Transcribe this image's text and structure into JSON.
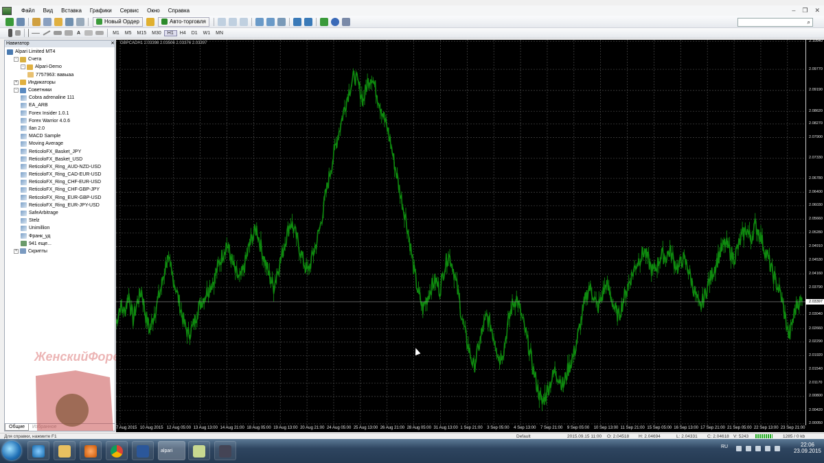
{
  "menu": {
    "items": [
      "Файл",
      "Вид",
      "Вставка",
      "Графики",
      "Сервис",
      "Окно",
      "Справка"
    ]
  },
  "toolbar": {
    "new_order": "Новый Ордер",
    "auto_trading": "Авто-торговля",
    "timeframes": [
      "M1",
      "M5",
      "M15",
      "M30",
      "H1",
      "H4",
      "D1",
      "W1",
      "MN"
    ]
  },
  "navigator": {
    "title": "Навигатор",
    "items": [
      {
        "label": "Alpari Limited MT4",
        "level": 0,
        "icon": "terminal-icon"
      },
      {
        "label": "Счета",
        "level": 1,
        "icon": "accounts-icon",
        "expand": "-"
      },
      {
        "label": "Alpari-Demo",
        "level": 2,
        "icon": "server-icon",
        "expand": "-"
      },
      {
        "label": "7757963: вавыаа",
        "level": 3,
        "icon": "user-icon"
      },
      {
        "label": "Индикаторы",
        "level": 1,
        "icon": "indicators-icon",
        "expand": "+"
      },
      {
        "label": "Советники",
        "level": 1,
        "icon": "experts-icon",
        "expand": "-"
      },
      {
        "label": "Cobra adrenaline 111",
        "level": 2,
        "icon": "ea-icon"
      },
      {
        "label": "EA_ARB",
        "level": 2,
        "icon": "ea-icon"
      },
      {
        "label": "Forex Insider 1.0.1",
        "level": 2,
        "icon": "ea-icon"
      },
      {
        "label": "Forex Warrior 4.0.6",
        "level": 2,
        "icon": "ea-icon"
      },
      {
        "label": "Ilan 2.0",
        "level": 2,
        "icon": "ea-icon"
      },
      {
        "label": "MACD Sample",
        "level": 2,
        "icon": "ea-icon"
      },
      {
        "label": "Moving Average",
        "level": 2,
        "icon": "ea-icon"
      },
      {
        "label": "ReticoloFX_Basket_JPY",
        "level": 2,
        "icon": "ea-icon"
      },
      {
        "label": "ReticoloFX_Basket_USD",
        "level": 2,
        "icon": "ea-icon"
      },
      {
        "label": "ReticoloFX_Ring_AUD-NZD-USD",
        "level": 2,
        "icon": "ea-icon"
      },
      {
        "label": "ReticoloFX_Ring_CAD-EUR-USD",
        "level": 2,
        "icon": "ea-icon"
      },
      {
        "label": "ReticoloFX_Ring_CHF-EUR-USD",
        "level": 2,
        "icon": "ea-icon"
      },
      {
        "label": "ReticoloFX_Ring_CHF-GBP-JPY",
        "level": 2,
        "icon": "ea-icon"
      },
      {
        "label": "ReticoloFX_Ring_EUR-GBP-USD",
        "level": 2,
        "icon": "ea-icon"
      },
      {
        "label": "ReticoloFX_Ring_EUR-JPY-USD",
        "level": 2,
        "icon": "ea-icon"
      },
      {
        "label": "SafeArbitrage",
        "level": 2,
        "icon": "ea-icon"
      },
      {
        "label": "Stelz",
        "level": 2,
        "icon": "ea-icon"
      },
      {
        "label": "Unimillion",
        "level": 2,
        "icon": "ea-icon"
      },
      {
        "label": "Франк_уд",
        "level": 2,
        "icon": "ea-icon"
      },
      {
        "label": "941 еще...",
        "level": 2,
        "icon": "more-icon"
      },
      {
        "label": "Скрипты",
        "level": 1,
        "icon": "scripts-icon",
        "expand": "+"
      }
    ],
    "tabs": [
      "Общие",
      "Избранное"
    ]
  },
  "watermark": "ЖенскийФорекс.ру",
  "chart": {
    "info": "GBPCADH1  2.03398 2.03506 2.03376 2.03397",
    "current_price": "2.03397",
    "line_color": "#0f8a0f",
    "grid_color": "#4a4a4a"
  },
  "chart_data": {
    "type": "line",
    "title": "",
    "xlabel": "",
    "ylabel": "",
    "ylim": [
      2.0001,
      2.1058
    ],
    "y_ticks": [
      "2.10540",
      "2.09770",
      "2.09190",
      "2.08620",
      "2.08270",
      "2.07900",
      "2.07330",
      "2.06780",
      "2.06400",
      "2.06030",
      "2.05660",
      "2.05280",
      "2.04910",
      "2.04530",
      "2.04160",
      "2.03790",
      "2.03397",
      "2.03040",
      "2.02660",
      "2.02290",
      "2.01920",
      "2.01540",
      "2.01170",
      "2.00800",
      "2.00420",
      "2.00050"
    ],
    "x_ticks": [
      "7 Aug 2015",
      "10 Aug 2015",
      "12 Aug 05:00",
      "13 Aug 13:00",
      "14 Aug 21:00",
      "18 Aug 05:00",
      "19 Aug 13:00",
      "20 Aug 21:00",
      "24 Aug 05:00",
      "25 Aug 13:00",
      "26 Aug 21:00",
      "28 Aug 05:00",
      "31 Aug 13:00",
      "1 Sep 21:00",
      "3 Sep 05:00",
      "4 Sep 13:00",
      "7 Sep 21:00",
      "9 Sep 05:00",
      "10 Sep 13:00",
      "11 Sep 21:00",
      "15 Sep 05:00",
      "16 Sep 13:00",
      "17 Sep 21:00",
      "21 Sep 05:00",
      "22 Sep 13:00",
      "23 Sep 21:00"
    ],
    "series": [
      {
        "values": [
          2.028,
          2.033,
          2.031,
          2.036,
          2.029,
          2.034,
          2.037,
          2.03,
          2.026,
          2.031,
          2.035,
          2.04,
          2.046,
          2.042,
          2.038,
          2.033,
          2.028,
          2.025,
          2.027,
          2.031,
          2.034,
          2.036,
          2.038,
          2.04,
          2.044,
          2.047,
          2.05,
          2.046,
          2.042,
          2.04,
          2.043,
          2.048,
          2.052,
          2.054,
          2.049,
          2.045,
          2.041,
          2.038,
          2.043,
          2.047,
          2.052,
          2.056,
          2.053,
          2.049,
          2.045,
          2.042,
          2.046,
          2.05,
          2.055,
          2.062,
          2.068,
          2.074,
          2.079,
          2.084,
          2.089,
          2.093,
          2.096,
          2.093,
          2.089,
          2.094,
          2.096,
          2.092,
          2.088,
          2.084,
          2.08,
          2.074,
          2.068,
          2.062,
          2.057,
          2.05,
          2.042,
          2.036,
          2.032,
          2.035,
          2.038,
          2.04,
          2.037,
          2.043,
          2.047,
          2.044,
          2.038,
          2.031,
          2.025,
          2.02,
          2.016,
          2.021,
          2.026,
          2.03,
          2.027,
          2.023,
          2.018,
          2.021,
          2.028,
          2.033,
          2.035,
          2.031,
          2.026,
          2.021,
          2.015,
          2.01,
          2.006,
          2.009,
          2.012,
          2.015,
          2.013,
          2.011,
          2.015,
          2.018,
          2.022,
          2.028,
          2.034,
          2.038,
          2.036,
          2.032,
          2.035,
          2.039,
          2.036,
          2.032,
          2.03,
          2.034,
          2.038,
          2.041,
          2.044,
          2.046,
          2.048,
          2.045,
          2.042,
          2.044,
          2.047,
          2.046,
          2.048,
          2.045,
          2.043,
          2.046,
          2.044,
          2.04,
          2.036,
          2.032,
          2.035,
          2.039,
          2.042,
          2.045,
          2.048,
          2.05,
          2.048,
          2.046,
          2.049,
          2.052,
          2.054,
          2.051,
          2.055,
          2.053,
          2.049,
          2.046,
          2.042,
          2.039,
          2.036,
          2.03,
          2.024,
          2.03,
          2.034,
          2.03397
        ]
      }
    ]
  },
  "status": {
    "help": "Для справки, нажмите F1",
    "profile": "Default",
    "datetime": "2015.09.15 11:00",
    "open": "O: 2.04518",
    "high": "H: 2.04694",
    "low": "L: 2.04331",
    "close": "C: 2.04618",
    "volume": "V: 5243",
    "traffic": "1285 / 0 kb"
  },
  "taskbar": {
    "mt4_label": "alpari",
    "language": "RU",
    "time": "22:06",
    "date": "23.09.2015"
  }
}
